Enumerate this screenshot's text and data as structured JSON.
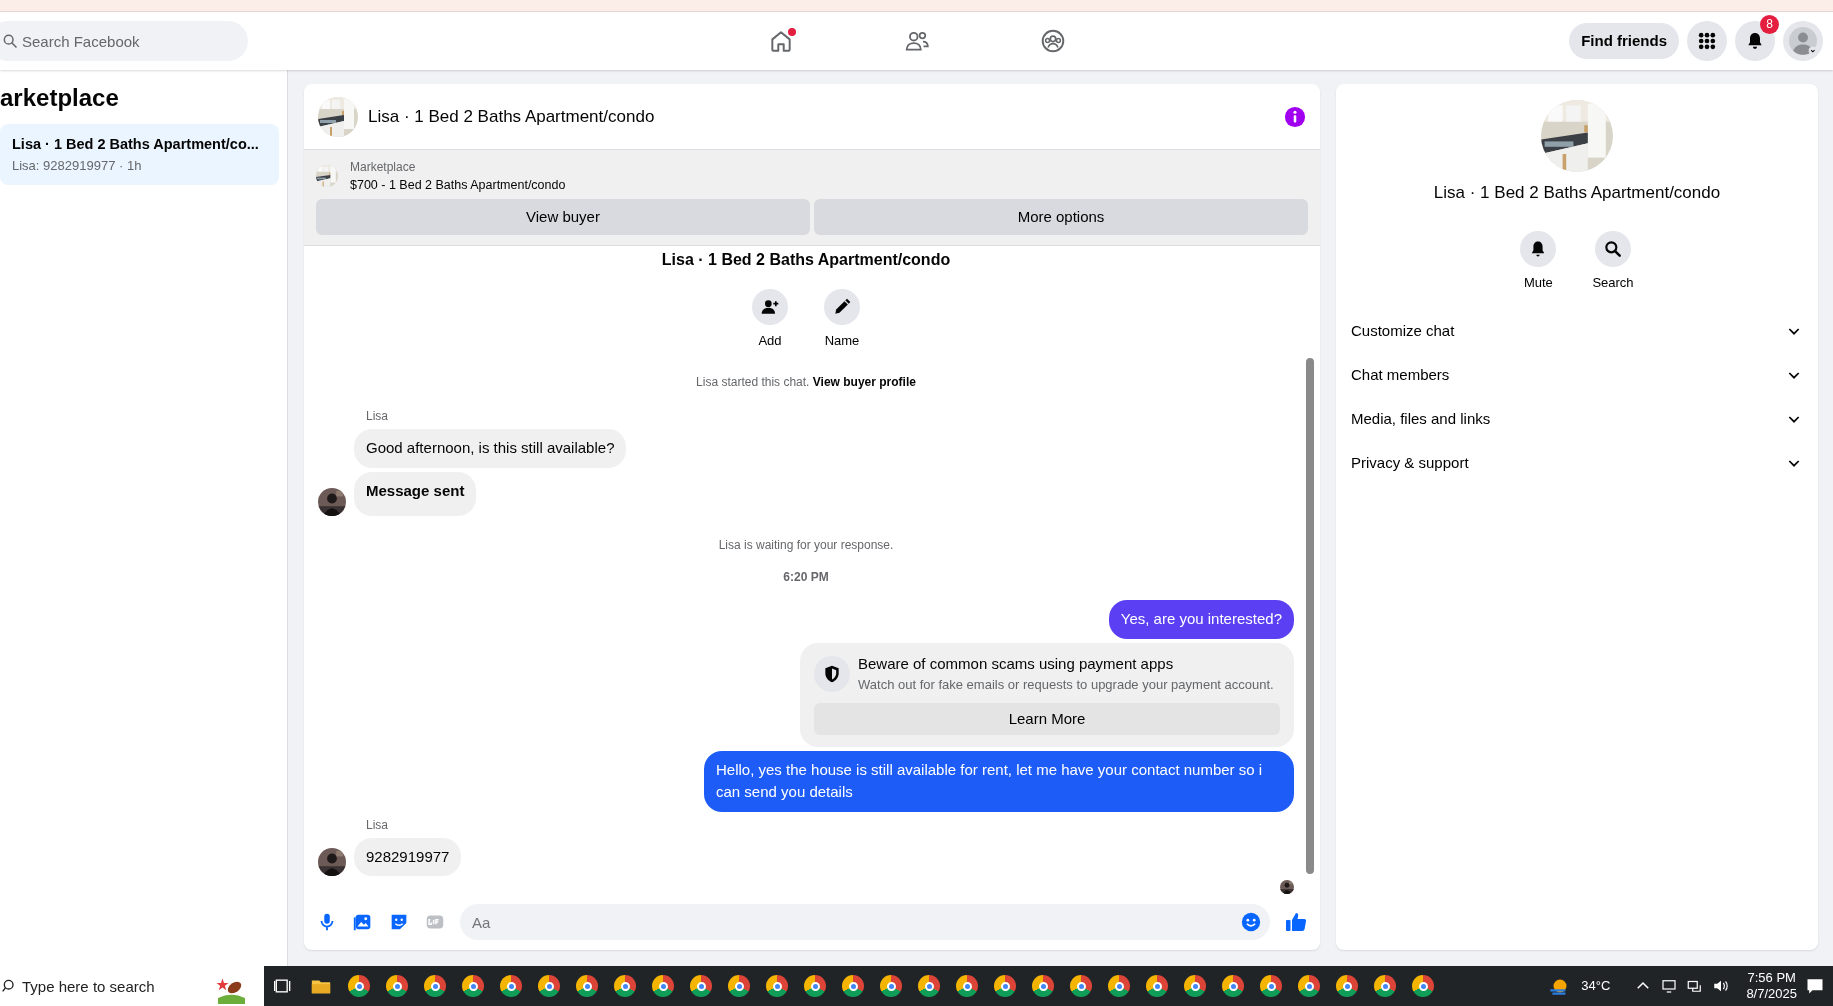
{
  "top_bar": {
    "search": {
      "placeholder": "Search Facebook"
    },
    "nav": [
      {
        "kind": "home",
        "selected": false,
        "dot": true
      },
      {
        "kind": "friends",
        "selected": false,
        "dot": false
      },
      {
        "kind": "groups",
        "selected": false,
        "dot": false
      }
    ],
    "find_friends": "Find friends",
    "notification_count": "8"
  },
  "sidebar": {
    "title": "arketplace",
    "conversations": [
      {
        "title": "Lisa · 1 Bed 2 Baths Apartment/co...",
        "subtitle": "Lisa: 9282919977 · 1h",
        "selected": true
      }
    ]
  },
  "chat": {
    "title": "Lisa · 1 Bed 2 Baths Apartment/condo",
    "listing": {
      "label": "Marketplace",
      "description": "$700 - 1 Bed 2 Baths Apartment/condo"
    },
    "actions": [
      "View buyer",
      "More options"
    ],
    "intro_title": "Lisa · 1 Bed 2 Baths Apartment/condo",
    "intro_actions": [
      {
        "kind": "add",
        "label": "Add"
      },
      {
        "kind": "name",
        "label": "Name"
      }
    ],
    "messages": [
      {
        "kind": "notice",
        "text": "Lisa started this chat.",
        "link": "View buyer profile"
      },
      {
        "kind": "incoming",
        "sender": "Lisa",
        "bubbles": [
          {
            "text": "Good afternoon, is this still available?",
            "bold": false
          },
          {
            "text": "Message sent",
            "bold": true
          }
        ]
      },
      {
        "kind": "notice",
        "text": "Lisa is waiting for your response."
      },
      {
        "kind": "timestamp",
        "text": "6:20 PM"
      },
      {
        "kind": "outgoing",
        "text": "Yes, are you interested?",
        "color": "#5b3ff2"
      },
      {
        "kind": "warning",
        "title": "Beware of common scams using payment apps",
        "text": "Watch out for fake emails or requests to upgrade your payment account.",
        "button": "Learn More"
      },
      {
        "kind": "outgoing",
        "text": "Hello, yes the house is still available for rent, let me have your contact number so i can send you details",
        "color": "#1d5cf6"
      },
      {
        "kind": "incoming",
        "sender": "Lisa",
        "bubbles": [
          {
            "text": "9282919977",
            "bold": false
          }
        ]
      }
    ],
    "composer": {
      "placeholder": "Aa"
    }
  },
  "details": {
    "title": "Lisa · 1 Bed 2 Baths Apartment/condo",
    "actions": [
      {
        "kind": "mute",
        "label": "Mute"
      },
      {
        "kind": "search",
        "label": "Search"
      }
    ],
    "sections": [
      {
        "label": "Customize chat",
        "expanded": false
      },
      {
        "label": "Chat members",
        "expanded": false
      },
      {
        "label": "Media, files and links",
        "expanded": false
      },
      {
        "label": "Privacy & support",
        "expanded": false
      }
    ]
  },
  "taskbar": {
    "search": {
      "placeholder": "Type here to search"
    },
    "temperature": "34°C",
    "time": "7:56 PM",
    "date": "8/7/2025"
  }
}
